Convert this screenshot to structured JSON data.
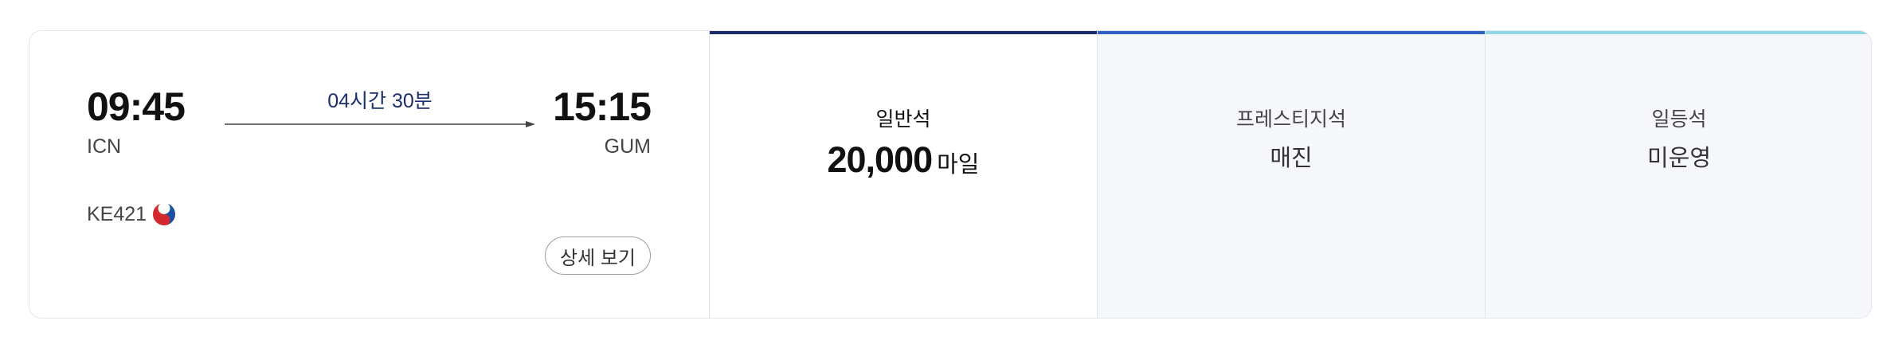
{
  "flight": {
    "departure_time": "09:45",
    "departure_airport": "ICN",
    "arrival_time": "15:15",
    "arrival_airport": "GUM",
    "duration": "04시간 30분",
    "flight_number": "KE421",
    "detail_button": "상세 보기"
  },
  "fares": [
    {
      "name": "일반석",
      "miles": "20,000",
      "unit": "마일",
      "bar_color": "#1c2d6b",
      "selected": true
    },
    {
      "name": "프레스티지석",
      "status": "매진",
      "bar_color": "#2f5fc4"
    },
    {
      "name": "일등석",
      "status": "미운영",
      "bar_color": "#8fd6e6"
    }
  ],
  "colors": {
    "border": "#e3e5ea",
    "unavailable_bg": "#f6f7fb",
    "duration_text": "#1c2d6b"
  }
}
